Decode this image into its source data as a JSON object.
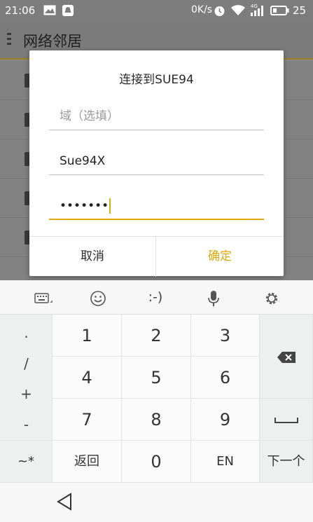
{
  "status_bar": {
    "time": "21:06",
    "network_speed": "0K/s",
    "signal_type": "4G",
    "battery": "25",
    "icons": [
      "image-icon",
      "notification-bell-icon",
      "alarm-icon",
      "wifi-icon",
      "signal-icon",
      "battery-icon"
    ]
  },
  "app_bar": {
    "title": "网络邻居"
  },
  "dialog": {
    "title": "连接到SUE94",
    "domain_placeholder": "域（选填）",
    "username_value": "Sue94X",
    "password_value": "•••••••",
    "cancel_label": "取消",
    "ok_label": "确定",
    "accent_color": "#e0a70d"
  },
  "keyboard": {
    "toolbar": {
      "emoticon_text": ":-)",
      "icons": [
        "keyboard-switch-icon",
        "emoji-icon",
        "emoticon-icon",
        "microphone-icon",
        "settings-icon"
      ]
    },
    "symbols": [
      ".",
      "/",
      "+",
      "-"
    ],
    "digits": [
      "1",
      "2",
      "3",
      "4",
      "5",
      "6",
      "7",
      "8",
      "9"
    ],
    "zero": "0",
    "symbol_toggle": "~*",
    "back_label": "返回",
    "lang_label": "EN",
    "next_label": "下一个",
    "backspace_icon": "backspace-icon",
    "space_icon": "space-icon"
  },
  "navbar": {
    "back_icon": "nav-back-icon"
  }
}
